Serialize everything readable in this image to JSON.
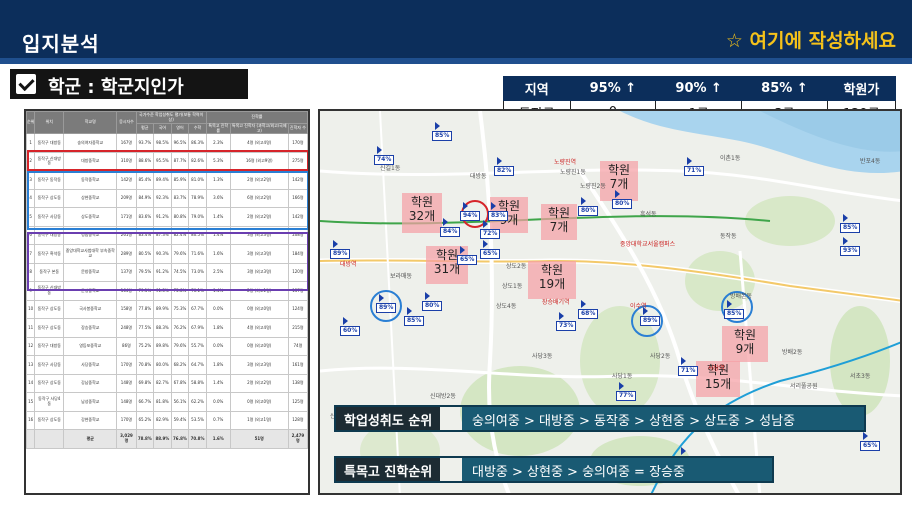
{
  "header": {
    "title": "입지분석",
    "note": "☆ 여기에 작성하세요"
  },
  "section": {
    "label": "학군 : 학군지인가"
  },
  "summary": {
    "headers": [
      "지역",
      "95% ↑",
      "90% ↑",
      "85% ↑",
      "학원가"
    ],
    "row": [
      "동작구",
      "0",
      "1곳",
      "3곳",
      "129곳"
    ]
  },
  "data_table": {
    "group_header": "국가수준 학업성취도 평가(보통 학력이상)",
    "group_header2": "진학률",
    "columns": [
      "순위",
      "위치",
      "학교명",
      "응시자수",
      "평균",
      "국어",
      "영어",
      "수학",
      "특목고 진학률",
      "특목고 진학자 (과학고/외고/국제고)",
      "진학자 수"
    ],
    "rows": [
      [
        "1",
        "동작구 대방동",
        "숭의여자중학교",
        "167명",
        "93.7%",
        "98.5%",
        "96.5%",
        "86.3%",
        "2.3%",
        "4명 (외고4명)",
        "170명"
      ],
      [
        "2",
        "동작구 신대방동",
        "대방중학교",
        "310명",
        "88.6%",
        "95.5%",
        "87.7%",
        "82.6%",
        "5.3%",
        "16명 (외고9명)",
        "275명"
      ],
      [
        "3",
        "동작구 동작동",
        "동작중학교",
        "142명",
        "85.4%",
        "89.4%",
        "85.9%",
        "81.0%",
        "1.3%",
        "2명 (외고2명)",
        "142명"
      ],
      [
        "4",
        "동작구 상도동",
        "상현중학교",
        "209명",
        "84.9%",
        "92.3%",
        "83.7%",
        "78.9%",
        "3.6%",
        "6명 (외고2명)",
        "166명"
      ],
      [
        "5",
        "동작구 사당동",
        "상도중학교",
        "171명",
        "83.6%",
        "91.2%",
        "80.8%",
        "79.0%",
        "1.4%",
        "2명 (외고2명)",
        "142명"
      ],
      [
        "6",
        "동작구 대방동",
        "성남중학교",
        "261명",
        "83.4%",
        "87.3%",
        "82.4%",
        "80.5%",
        "1.4%",
        "3명 (외고3명)",
        "208명"
      ],
      [
        "7",
        "동작구 흑석동",
        "중앙대학교사범대학 부속중학교",
        "289명",
        "80.5%",
        "90.3%",
        "79.6%",
        "71.6%",
        "1.6%",
        "3명 (외고3명)",
        "184명"
      ],
      [
        "8",
        "동작구 본동",
        "문창중학교",
        "137명",
        "79.5%",
        "91.2%",
        "74.5%",
        "73.0%",
        "2.5%",
        "3명 (외고3명)",
        "120명"
      ],
      [
        "9",
        "동작구 신대방동",
        "문성중학교",
        "164명",
        "79.1%",
        "91.5%",
        "75.8%",
        "70.1%",
        "1.4%",
        "2명 (외고1명)",
        "137명"
      ],
      [
        "10",
        "동작구 상도동",
        "국사봉중학교",
        "158명",
        "77.8%",
        "89.9%",
        "75.3%",
        "67.7%",
        "0.0%",
        "0명 (외고0명)",
        "124명"
      ],
      [
        "11",
        "동작구 상도동",
        "장승중학교",
        "248명",
        "77.5%",
        "88.3%",
        "76.2%",
        "67.9%",
        "1.8%",
        "4명 (외고4명)",
        "215명"
      ],
      [
        "12",
        "동작구 대방동",
        "영등포중학교",
        "86명",
        "75.2%",
        "89.8%",
        "79.6%",
        "55.7%",
        "0.0%",
        "0명 (외고0명)",
        "74명"
      ],
      [
        "13",
        "동작구 사당동",
        "사당중학교",
        "170명",
        "70.8%",
        "80.0%",
        "68.2%",
        "64.7%",
        "1.8%",
        "3명 (외고3명)",
        "161명"
      ],
      [
        "14",
        "동작구 상도동",
        "강남중학교",
        "148명",
        "69.8%",
        "82.7%",
        "67.8%",
        "58.8%",
        "1.4%",
        "2명 (외고2명)",
        "138명"
      ],
      [
        "15",
        "동작구 사당4동",
        "남성중학교",
        "148명",
        "66.7%",
        "81.8%",
        "56.1%",
        "62.2%",
        "0.0%",
        "0명 (외고0명)",
        "125명"
      ],
      [
        "16",
        "동작구 상도동",
        "강현중학교",
        "170명",
        "65.2%",
        "82.9%",
        "59.4%",
        "53.5%",
        "0.7%",
        "1명 (외고1명)",
        "128명"
      ]
    ],
    "total": [
      "",
      "",
      "평균",
      "3,029명",
      "78.8%",
      "88.9%",
      "76.8%",
      "70.8%",
      "1.6%",
      "51명",
      "2,479명"
    ]
  },
  "map": {
    "academy_boxes": [
      {
        "line1": "학원",
        "line2": "32개"
      },
      {
        "line1": "학원",
        "line2": "9개"
      },
      {
        "line1": "학원",
        "line2": "7개"
      },
      {
        "line1": "학원",
        "line2": "7개"
      },
      {
        "line1": "학원",
        "line2": "31개"
      },
      {
        "line1": "학원",
        "line2": "19개"
      },
      {
        "line1": "학원",
        "line2": "9개"
      },
      {
        "line1": "학원",
        "line2": "15개"
      }
    ],
    "school_badges": [
      "85%",
      "74%",
      "82%",
      "94%",
      "83%",
      "89%",
      "84%",
      "80%",
      "71%",
      "80%",
      "85%",
      "65%",
      "65%",
      "72%",
      "89%",
      "80%",
      "89%",
      "60%",
      "85%",
      "71%",
      "77%",
      "79%",
      "65%",
      "93%",
      "73%",
      "85%",
      "68%"
    ],
    "place_labels": [
      "신길1동",
      "노량진1동",
      "노량진2동",
      "대방동",
      "흑석동",
      "상도1동",
      "상도2동",
      "상도4동",
      "신대방1동",
      "신대방2동",
      "사당1동",
      "사당2동",
      "사당3동",
      "동작동",
      "반포4동",
      "보라매동",
      "방배본동",
      "방배2동",
      "서초3동",
      "서리풀공원",
      "이촌1동"
    ],
    "red_labels": [
      "노량진역",
      "대방역",
      "장승배기역",
      "이수역",
      "사당역",
      "중앙대학교서울캠퍼스"
    ]
  },
  "rankings": [
    {
      "tag": "학업성취도 순위",
      "value": "숭의여중 > 대방중 > 동작중 > 상현중 > 상도중 > 성남중"
    },
    {
      "tag": "특목고 진학순위",
      "value": "대방중 > 상현중 > 숭의여중 = 장승중"
    }
  ]
}
